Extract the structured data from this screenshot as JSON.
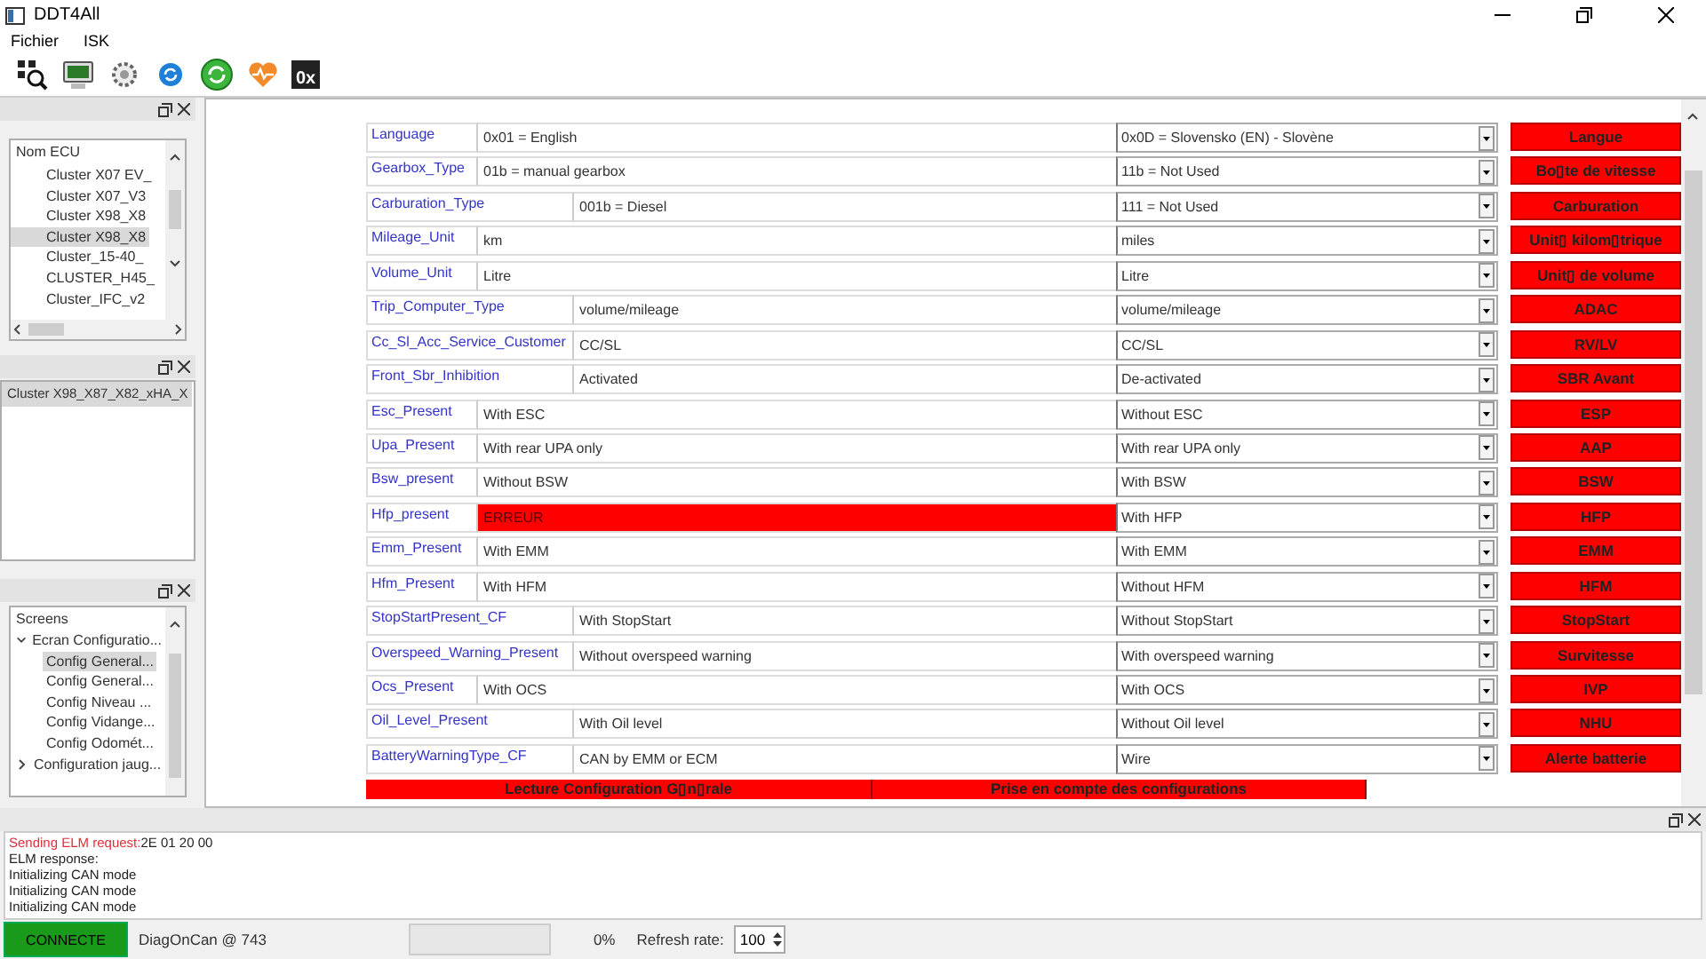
{
  "window": {
    "title": "DDT4All"
  },
  "menu": [
    "Fichier",
    "ISK"
  ],
  "toolbar": {
    "hex_label": "0x"
  },
  "ecu_panel": {
    "header": "Nom ECU",
    "items": [
      {
        "label": "Cluster X07 EV_",
        "selected": false
      },
      {
        "label": "Cluster X07_V3",
        "selected": false
      },
      {
        "label": "Cluster X98_X8",
        "selected": false
      },
      {
        "label": "Cluster X98_X8",
        "selected": true
      },
      {
        "label": "Cluster_15-40_",
        "selected": false
      },
      {
        "label": "CLUSTER_H45_",
        "selected": false
      },
      {
        "label": "Cluster_IFC_v2",
        "selected": false
      }
    ]
  },
  "ecu_selected_panel": {
    "items": [
      {
        "label": "Cluster X98_X87_X82_xHA_X",
        "selected": true
      }
    ]
  },
  "screens_panel": {
    "header": "Screens",
    "tree": [
      {
        "label": "Ecran Configuratio...",
        "expanded": true,
        "selected": false,
        "children": [
          {
            "label": "Config General...",
            "selected": true
          },
          {
            "label": "Config General...",
            "selected": false
          },
          {
            "label": "Config Niveau ...",
            "selected": false
          },
          {
            "label": "Config Vidange...",
            "selected": false
          },
          {
            "label": "Config Odomét...",
            "selected": false
          }
        ]
      },
      {
        "label": "Configuration jaug...",
        "expanded": false,
        "selected": false
      }
    ]
  },
  "config_rows": [
    {
      "name": "Language",
      "current": "0x01 = English",
      "error": false,
      "target": "0x0D = Slovensko (EN) - Slovène",
      "action": "Langue"
    },
    {
      "name": "Gearbox_Type",
      "current": "01b = manual gearbox",
      "error": false,
      "target": "11b = Not Used",
      "action": "Bo▯te de vitesse"
    },
    {
      "name": "Carburation_Type",
      "current": "001b = Diesel",
      "error": false,
      "target": "111 = Not Used",
      "action": "Carburation"
    },
    {
      "name": "Mileage_Unit",
      "current": "km",
      "error": false,
      "target": "miles",
      "action": "Unit▯ kilom▯trique"
    },
    {
      "name": "Volume_Unit",
      "current": "Litre",
      "error": false,
      "target": "Litre",
      "action": "Unit▯ de volume"
    },
    {
      "name": "Trip_Computer_Type",
      "current": "volume/mileage",
      "error": false,
      "target": "volume/mileage",
      "action": "ADAC"
    },
    {
      "name": "Cc_Sl_Acc_Service_Customer",
      "current": "CC/SL",
      "error": false,
      "target": "CC/SL",
      "action": "RV/LV"
    },
    {
      "name": "Front_Sbr_Inhibition",
      "current": "Activated",
      "error": false,
      "target": "De-activated",
      "action": "SBR Avant"
    },
    {
      "name": "Esc_Present",
      "current": "With ESC",
      "error": false,
      "target": "Without ESC",
      "action": "ESP"
    },
    {
      "name": "Upa_Present",
      "current": "With rear UPA only",
      "error": false,
      "target": "With rear UPA only",
      "action": "AAP"
    },
    {
      "name": "Bsw_present",
      "current": "Without BSW",
      "error": false,
      "target": "With BSW",
      "action": "BSW"
    },
    {
      "name": "Hfp_present",
      "current": "ERREUR",
      "error": true,
      "target": "With HFP",
      "action": "HFP"
    },
    {
      "name": "Emm_Present",
      "current": "With EMM",
      "error": false,
      "target": "With EMM",
      "action": "EMM"
    },
    {
      "name": "Hfm_Present",
      "current": "With HFM",
      "error": false,
      "target": "Without HFM",
      "action": "HFM"
    },
    {
      "name": "StopStartPresent_CF",
      "current": "With StopStart",
      "error": false,
      "target": "Without StopStart",
      "action": "StopStart"
    },
    {
      "name": "Overspeed_Warning_Present",
      "current": "Without overspeed warning",
      "error": false,
      "target": "With overspeed warning",
      "action": "Survitesse"
    },
    {
      "name": "Ocs_Present",
      "current": "With OCS",
      "error": false,
      "target": "With OCS",
      "action": "IVP"
    },
    {
      "name": "Oil_Level_Present",
      "current": "With Oil  level",
      "error": false,
      "target": "Without Oil  level",
      "action": "NHU"
    },
    {
      "name": "BatteryWarningType_CF",
      "current": "CAN by EMM or ECM",
      "error": false,
      "target": "Wire",
      "action": "Alerte batterie"
    }
  ],
  "bottom_buttons": [
    "Lecture Configuration G▯n▯rale",
    "Prise en compte des configurations"
  ],
  "log": [
    {
      "kind": "request",
      "label": "Sending ELM request:",
      "value": "2E 01 20 00"
    },
    {
      "kind": "plain",
      "label": "ELM response:"
    },
    {
      "kind": "plain",
      "label": "Initializing CAN mode"
    },
    {
      "kind": "plain",
      "label": "Initializing CAN mode"
    },
    {
      "kind": "plain",
      "label": "Initializing CAN mode"
    }
  ],
  "status_bar": {
    "connection": "CONNECTE",
    "connected": true,
    "protocol": "DiagOnCan @ 743",
    "progress": {
      "level": 0
    },
    "percent": "0%",
    "refresh_label": "Refresh rate:",
    "refresh_value": "100"
  }
}
